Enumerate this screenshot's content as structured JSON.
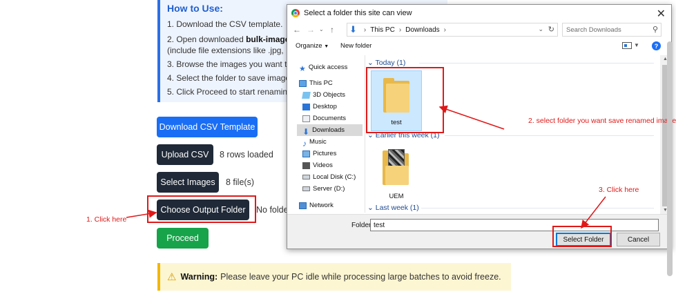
{
  "howto": {
    "title": "How to Use:",
    "steps": [
      "1. Download the CSV template.",
      "2. Open downloaded ",
      "(include file extensions like .jpg, .p",
      "3. Browse the images you want to",
      "4. Select the folder to save images.",
      "5. Click Proceed to start renaming."
    ],
    "step2_bold": "bulk-image-"
  },
  "buttons": {
    "download_csv": "Download CSV Template",
    "upload_csv": "Upload CSV",
    "select_images": "Select Images",
    "choose_output": "Choose Output Folder",
    "proceed": "Proceed"
  },
  "status": {
    "rows_loaded": "8 rows loaded",
    "files": "8 file(s)",
    "no_folder": "No folde"
  },
  "warning": {
    "label": "Warning:",
    "text": "Please leave your PC idle while processing large batches to avoid freeze."
  },
  "annotations": {
    "step1": "1. Click here",
    "step2": "2. select folder you want save renamed image",
    "step3": "3. Click here"
  },
  "dialog": {
    "title": "Select a folder this site can view",
    "breadcrumb": [
      "This PC",
      "Downloads"
    ],
    "search_placeholder": "Search Downloads",
    "toolbar": {
      "organize": "Organize",
      "new_folder": "New folder"
    },
    "nav": [
      {
        "label": "Quick access",
        "icon": "star-icon"
      },
      {
        "label": "This PC",
        "icon": "computer-icon"
      },
      {
        "label": "3D Objects",
        "icon": "3d-objects-icon"
      },
      {
        "label": "Desktop",
        "icon": "desktop-icon"
      },
      {
        "label": "Documents",
        "icon": "documents-icon"
      },
      {
        "label": "Downloads",
        "icon": "download-icon"
      },
      {
        "label": "Music",
        "icon": "music-icon"
      },
      {
        "label": "Pictures",
        "icon": "pictures-icon"
      },
      {
        "label": "Videos",
        "icon": "videos-icon"
      },
      {
        "label": "Local Disk (C:)",
        "icon": "disk-icon"
      },
      {
        "label": "Server (D:)",
        "icon": "disk-icon"
      },
      {
        "label": "Network",
        "icon": "network-icon"
      }
    ],
    "groups": [
      {
        "label": "Today (1)",
        "items": [
          "test"
        ]
      },
      {
        "label": "Earlier this week (1)",
        "items": [
          "UEM"
        ]
      },
      {
        "label": "Last week (1)",
        "items": []
      }
    ],
    "folder_label": "Folder:",
    "folder_value": "test",
    "select_button": "Select Folder",
    "cancel_button": "Cancel"
  },
  "colors": {
    "annotation": "#e01818",
    "primary_blue": "#1a6ef5",
    "dark_button": "#1f2937",
    "proceed_green": "#17a34a",
    "warning_bg": "#fdf6d2"
  }
}
